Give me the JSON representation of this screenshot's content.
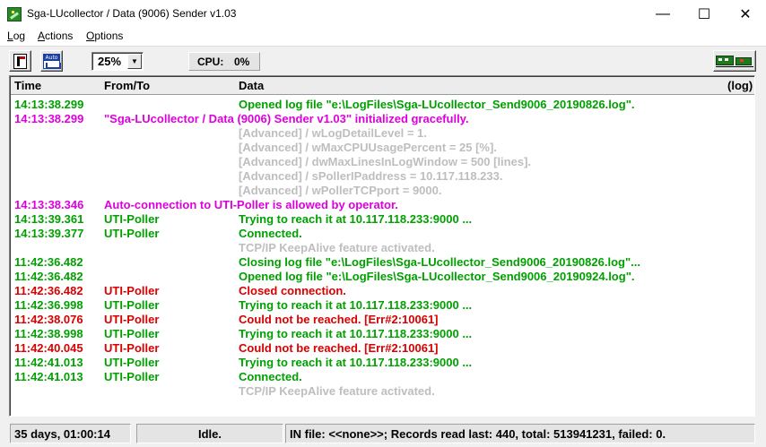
{
  "window": {
    "title": "Sga-LUcollector / Data (9006) Sender  v1.03",
    "controls": {
      "minimize": "—",
      "maximize": "☐",
      "close": "✕"
    }
  },
  "menu": [
    {
      "hotkey": "L",
      "rest": "og"
    },
    {
      "hotkey": "A",
      "rest": "ctions"
    },
    {
      "hotkey": "O",
      "rest": "ptions"
    }
  ],
  "toolbar": {
    "zoom": "25%",
    "zoom_arrow": "▼",
    "cpu_label": "CPU:",
    "cpu_value": "0%",
    "icons": [
      "log-file-icon",
      "auto-connect-icon",
      "train-icon"
    ]
  },
  "log": {
    "columns": {
      "time": "Time",
      "from": "From/To",
      "data": "Data",
      "log": "(log)"
    },
    "rows": [
      {
        "time": "14:13:38.299",
        "from": "",
        "data": "Opened log file \"e:\\LogFiles\\Sga-LUcollector_Send9006_20190826.log\".",
        "color": "#00a000"
      },
      {
        "time": "14:13:38.299",
        "wide": "\"Sga-LUcollector / Data (9006) Sender  v1.03\" initialized gracefully.",
        "color": "#dd00dd"
      },
      {
        "time": "",
        "from": "",
        "data": "[Advanced] / wLogDetailLevel = 1.",
        "color": "#bebebe"
      },
      {
        "time": "",
        "from": "",
        "data": "[Advanced] / wMaxCPUUsagePercent = 25 [%].",
        "color": "#bebebe"
      },
      {
        "time": "",
        "from": "",
        "data": "[Advanced] / dwMaxLinesInLogWindow = 500 [lines].",
        "color": "#bebebe"
      },
      {
        "time": "",
        "from": "",
        "data": "[Advanced] / sPollerIPaddress = 10.117.118.233.",
        "color": "#bebebe"
      },
      {
        "time": "",
        "from": "",
        "data": "[Advanced] / wPollerTCPport = 9000.",
        "color": "#bebebe"
      },
      {
        "time": "14:13:38.346",
        "wide": "Auto-connection to UTI-Poller is allowed by operator.",
        "color": "#dd00dd"
      },
      {
        "time": "14:13:39.361",
        "from": "UTI-Poller",
        "data": "Trying to reach it at 10.117.118.233:9000 ...",
        "color": "#00a000"
      },
      {
        "time": "14:13:39.377",
        "from": "UTI-Poller",
        "data": "Connected.",
        "color": "#00a000"
      },
      {
        "time": "",
        "from": "",
        "data": "TCP/IP KeepAlive feature activated.",
        "color": "#bebebe"
      },
      {
        "time": "11:42:36.482",
        "from": "",
        "data": "Closing log file \"e:\\LogFiles\\Sga-LUcollector_Send9006_20190826.log\"...",
        "color": "#00a000"
      },
      {
        "time": "11:42:36.482",
        "from": "",
        "data": "Opened log file \"e:\\LogFiles\\Sga-LUcollector_Send9006_20190924.log\".",
        "color": "#00a000"
      },
      {
        "time": "11:42:36.482",
        "from": "UTI-Poller",
        "data": "Closed connection.",
        "color": "#d80000"
      },
      {
        "time": "11:42:36.998",
        "from": "UTI-Poller",
        "data": "Trying to reach it at 10.117.118.233:9000 ...",
        "color": "#00a000"
      },
      {
        "time": "11:42:38.076",
        "from": "UTI-Poller",
        "data": "Could not be reached.  [Err#2:10061]",
        "color": "#d80000"
      },
      {
        "time": "11:42:38.998",
        "from": "UTI-Poller",
        "data": "Trying to reach it at 10.117.118.233:9000 ...",
        "color": "#00a000"
      },
      {
        "time": "11:42:40.045",
        "from": "UTI-Poller",
        "data": "Could not be reached.  [Err#2:10061]",
        "color": "#d80000"
      },
      {
        "time": "11:42:41.013",
        "from": "UTI-Poller",
        "data": "Trying to reach it at 10.117.118.233:9000 ...",
        "color": "#00a000"
      },
      {
        "time": "11:42:41.013",
        "from": "UTI-Poller",
        "data": "Connected.",
        "color": "#00a000"
      },
      {
        "time": "",
        "from": "",
        "data": "TCP/IP KeepAlive feature activated.",
        "color": "#bebebe"
      }
    ]
  },
  "status": {
    "uptime": "35 days, 01:00:14",
    "state": "Idle.",
    "file_info": "IN file: <<none>>;  Records read last: 440,  total: 513941231,  failed: 0."
  },
  "colors": {
    "ok": "#00a000",
    "info": "#dd00dd",
    "error": "#d80000",
    "detail": "#bebebe"
  }
}
